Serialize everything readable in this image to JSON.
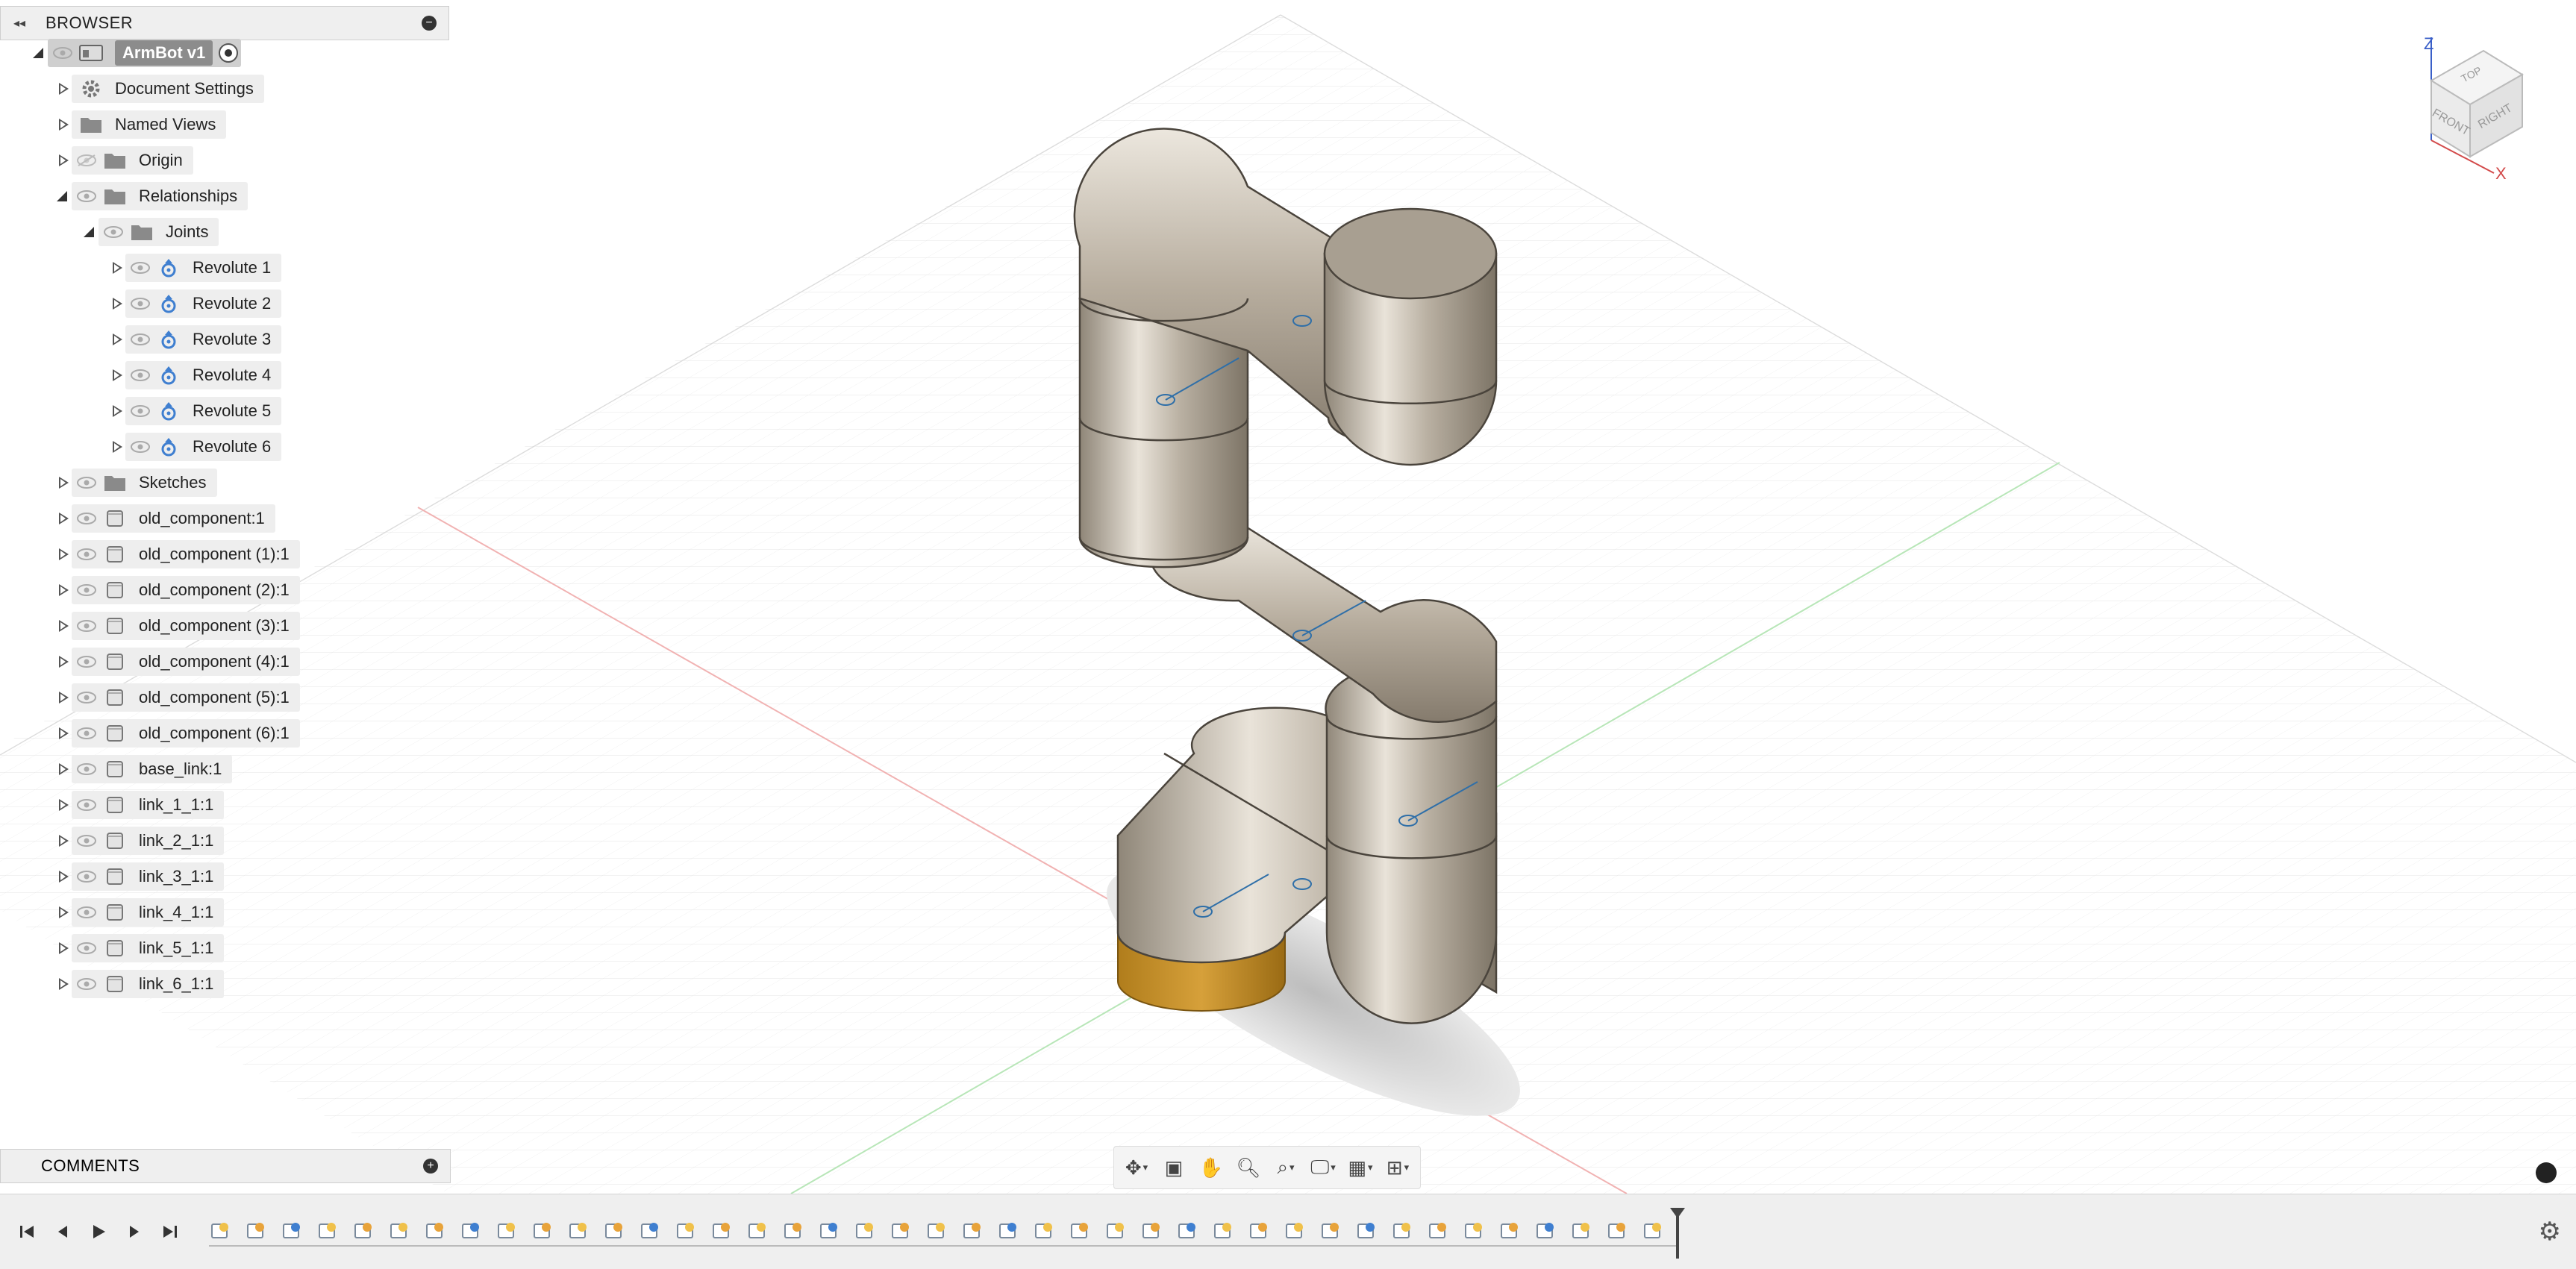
{
  "browser": {
    "title": "BROWSER",
    "root": {
      "label": "ArmBot v1"
    },
    "items": [
      {
        "label": "Document Settings",
        "icon": "gear-icon"
      },
      {
        "label": "Named Views",
        "icon": "folder-icon"
      },
      {
        "label": "Origin",
        "icon": "folder-icon",
        "hidden": true
      },
      {
        "label": "Relationships",
        "icon": "folder-icon",
        "expanded": true
      },
      {
        "label": "Joints",
        "icon": "folder-icon",
        "expanded": true
      },
      {
        "label": "Revolute 1",
        "icon": "revolute-joint-icon"
      },
      {
        "label": "Revolute 2",
        "icon": "revolute-joint-icon"
      },
      {
        "label": "Revolute 3",
        "icon": "revolute-joint-icon"
      },
      {
        "label": "Revolute 4",
        "icon": "revolute-joint-icon"
      },
      {
        "label": "Revolute 5",
        "icon": "revolute-joint-icon"
      },
      {
        "label": "Revolute 6",
        "icon": "revolute-joint-icon"
      },
      {
        "label": "Sketches",
        "icon": "folder-icon"
      },
      {
        "label": "old_component:1",
        "icon": "component-icon"
      },
      {
        "label": "old_component (1):1",
        "icon": "component-icon"
      },
      {
        "label": "old_component (2):1",
        "icon": "component-icon"
      },
      {
        "label": "old_component (3):1",
        "icon": "component-icon"
      },
      {
        "label": "old_component (4):1",
        "icon": "component-icon"
      },
      {
        "label": "old_component (5):1",
        "icon": "component-icon"
      },
      {
        "label": "old_component (6):1",
        "icon": "component-icon"
      },
      {
        "label": "base_link:1",
        "icon": "component-icon"
      },
      {
        "label": "link_1_1:1",
        "icon": "component-icon"
      },
      {
        "label": "link_2_1:1",
        "icon": "component-icon"
      },
      {
        "label": "link_3_1:1",
        "icon": "component-icon"
      },
      {
        "label": "link_4_1:1",
        "icon": "component-icon"
      },
      {
        "label": "link_5_1:1",
        "icon": "component-icon"
      },
      {
        "label": "link_6_1:1",
        "icon": "component-icon"
      }
    ]
  },
  "comments": {
    "title": "COMMENTS"
  },
  "viewcube": {
    "top": "TOP",
    "front": "FRONT",
    "right": "RIGHT",
    "axis_z": "Z",
    "axis_x": "X"
  },
  "colors": {
    "panel": "#efefef",
    "accent_blue": "#3f7fd0",
    "base_gold": "#c9962e",
    "arm_metal": "#b5ada3"
  }
}
